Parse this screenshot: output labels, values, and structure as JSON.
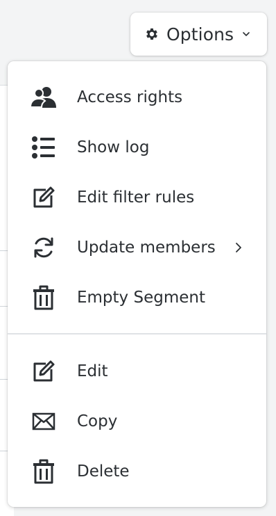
{
  "options_button": {
    "label": "Options",
    "icon": "gear-icon",
    "caret_icon": "chevron-down-icon"
  },
  "menu": {
    "group1": [
      {
        "label": "Access rights",
        "icon": "users-icon"
      },
      {
        "label": "Show log",
        "icon": "list-icon"
      },
      {
        "label": "Edit filter rules",
        "icon": "edit-icon"
      },
      {
        "label": "Update members",
        "icon": "refresh-icon",
        "has_submenu": true
      },
      {
        "label": "Empty Segment",
        "icon": "trash-icon"
      }
    ],
    "group2": [
      {
        "label": "Edit",
        "icon": "edit-icon"
      },
      {
        "label": "Copy",
        "icon": "envelope-icon"
      },
      {
        "label": "Delete",
        "icon": "trash-icon"
      }
    ]
  },
  "colors": {
    "text": "#2b2f33",
    "menu_bg": "#ffffff",
    "page_bg": "#f3f4f5",
    "divider": "#dfe2e5"
  }
}
